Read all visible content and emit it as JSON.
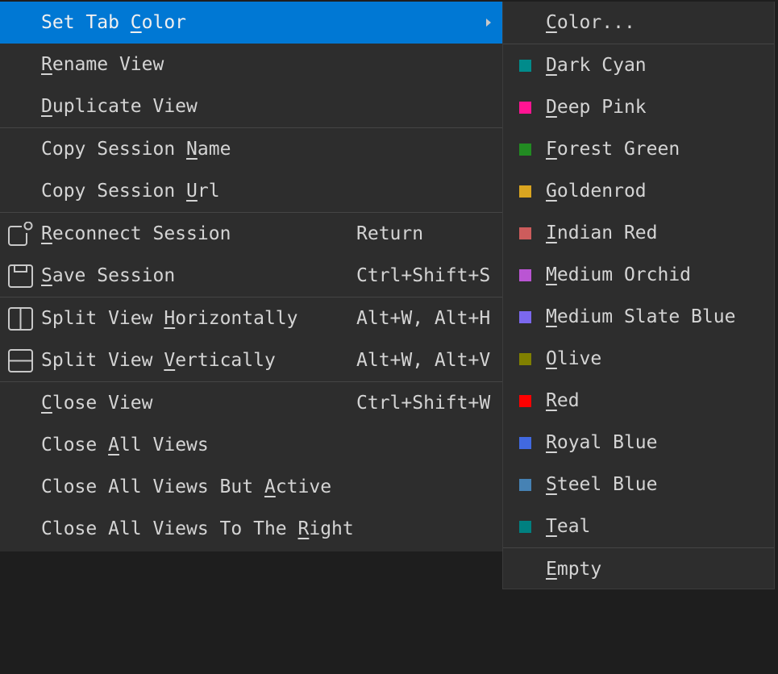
{
  "menu": {
    "items": [
      {
        "pre": "Set Tab ",
        "acc": "C",
        "post": "olor",
        "shortcut": "",
        "submenu": true
      },
      {
        "pre": "",
        "acc": "R",
        "post": "ename View",
        "shortcut": ""
      },
      {
        "pre": "",
        "acc": "D",
        "post": "uplicate View",
        "shortcut": ""
      },
      {
        "pre": "Copy Session ",
        "acc": "N",
        "post": "ame",
        "shortcut": ""
      },
      {
        "pre": "Copy Session ",
        "acc": "U",
        "post": "rl",
        "shortcut": ""
      },
      {
        "pre": "",
        "acc": "R",
        "post": "econnect Session",
        "shortcut": "Return",
        "icon": "reconnect-icon"
      },
      {
        "pre": "",
        "acc": "S",
        "post": "ave Session",
        "shortcut": "Ctrl+Shift+S",
        "icon": "save-icon"
      },
      {
        "pre": "Split View ",
        "acc": "H",
        "post": "orizontally",
        "shortcut": "Alt+W, Alt+H",
        "icon": "split-horizontal-icon"
      },
      {
        "pre": "Split View ",
        "acc": "V",
        "post": "ertically",
        "shortcut": "Alt+W, Alt+V",
        "icon": "split-vertical-icon"
      },
      {
        "pre": "",
        "acc": "C",
        "post": "lose View",
        "shortcut": "Ctrl+Shift+W"
      },
      {
        "pre": "Close ",
        "acc": "A",
        "post": "ll Views",
        "shortcut": ""
      },
      {
        "pre": "Close All Views But ",
        "acc": "A",
        "post": "ctive",
        "shortcut": ""
      },
      {
        "pre": "Close All Views To The ",
        "acc": "R",
        "post": "ight",
        "shortcut": ""
      }
    ]
  },
  "submenu": {
    "color": {
      "pre": "",
      "acc": "C",
      "post": "olor..."
    },
    "colors": [
      {
        "pre": "",
        "acc": "D",
        "post": "ark Cyan",
        "hex": "#008b8b"
      },
      {
        "pre": "",
        "acc": "D",
        "post": "eep Pink",
        "hex": "#ff1493"
      },
      {
        "pre": "",
        "acc": "F",
        "post": "orest Green",
        "hex": "#228b22"
      },
      {
        "pre": "",
        "acc": "G",
        "post": "oldenrod",
        "hex": "#daa520"
      },
      {
        "pre": "",
        "acc": "I",
        "post": "ndian Red",
        "hex": "#cd5c5c"
      },
      {
        "pre": "",
        "acc": "M",
        "post": "edium Orchid",
        "hex": "#ba55d3"
      },
      {
        "pre": "",
        "acc": "M",
        "post": "edium Slate Blue",
        "hex": "#7b68ee"
      },
      {
        "pre": "",
        "acc": "O",
        "post": "live",
        "hex": "#808000"
      },
      {
        "pre": "",
        "acc": "R",
        "post": "ed",
        "hex": "#ff0000"
      },
      {
        "pre": "",
        "acc": "R",
        "post": "oyal Blue",
        "hex": "#4169e1"
      },
      {
        "pre": "",
        "acc": "S",
        "post": "teel Blue",
        "hex": "#4682b4"
      },
      {
        "pre": "",
        "acc": "T",
        "post": "eal",
        "hex": "#008080"
      }
    ],
    "empty": {
      "pre": "",
      "acc": "E",
      "post": "mpty"
    }
  }
}
